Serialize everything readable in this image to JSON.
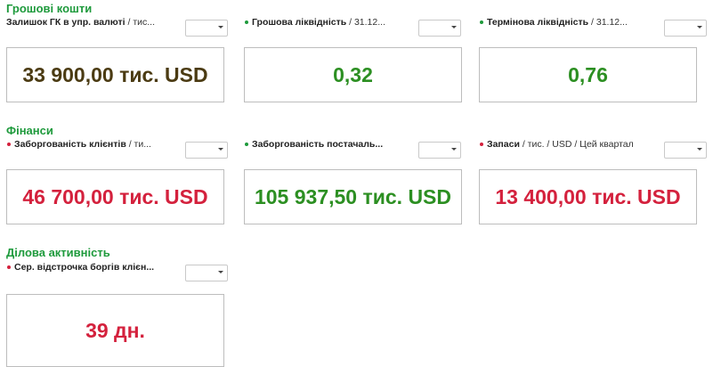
{
  "colors": {
    "section": "#1e9a3c",
    "value_dark": "#4b3b13",
    "value_green": "#2c8f22",
    "value_red": "#d4213d"
  },
  "sections": [
    {
      "title": "Грошові кошти",
      "widgets": [
        {
          "name": "Залишок ГК в упр. валюті",
          "suffix": " / тис...",
          "indicator": "none",
          "value": "33 900,00 тис. USD",
          "value_color": "dark"
        },
        {
          "name": "Грошова ліквідність",
          "suffix": " / 31.12...",
          "indicator": "green",
          "value": "0,32",
          "value_color": "green"
        },
        {
          "name": "Термінова ліквідність",
          "suffix": " / 31.12...",
          "indicator": "green",
          "value": "0,76",
          "value_color": "green"
        }
      ]
    },
    {
      "title": "Фінанси",
      "widgets": [
        {
          "name": "Заборгованість клієнтів",
          "suffix": " / ти...",
          "indicator": "red",
          "value": "46 700,00 тис. USD",
          "value_color": "red"
        },
        {
          "name": "Заборгованість постачаль...",
          "suffix": "",
          "indicator": "green",
          "value": "105 937,50 тис. USD",
          "value_color": "green"
        },
        {
          "name": "Запаси",
          "suffix": " / тис. / USD / Цей квартал",
          "indicator": "red",
          "value": "13 400,00 тис. USD",
          "value_color": "red"
        }
      ]
    },
    {
      "title": "Ділова активність",
      "widgets": [
        {
          "name": "Сер. відстрочка боргів клієн...",
          "suffix": "",
          "indicator": "red",
          "value": "39 дн.",
          "value_color": "red"
        }
      ]
    }
  ]
}
